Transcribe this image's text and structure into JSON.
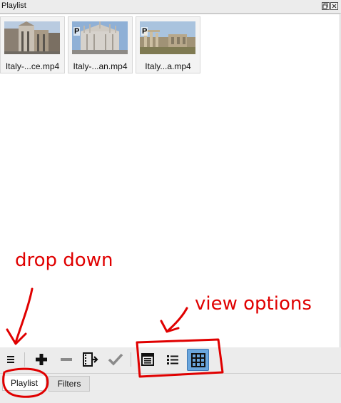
{
  "panel": {
    "title": "Playlist",
    "float_icon": "float-window-icon",
    "close_icon": "close-icon"
  },
  "playlist": {
    "items": [
      {
        "label": "Italy-...ce.mp4",
        "thumb": "florence-cathedral",
        "badge": ""
      },
      {
        "label": "Italy-...an.mp4",
        "thumb": "milan-cathedral",
        "badge": "P"
      },
      {
        "label": "Italy...a.mp4",
        "thumb": "roman-forum",
        "badge": "P"
      }
    ]
  },
  "annotations": {
    "dropdown": "drop down",
    "view_options": "view options",
    "color": "#e00000"
  },
  "toolbar": {
    "menu_icon": "hamburger-menu-icon",
    "add_icon": "plus-icon",
    "remove_icon": "minus-icon",
    "update_icon": "film-arrow-icon",
    "select_icon": "checkmark-icon",
    "view_details_icon": "details-view-icon",
    "view_list_icon": "list-view-icon",
    "view_tiles_icon": "tiles-view-icon",
    "selected_view": "tiles"
  },
  "tabs": {
    "playlist": "Playlist",
    "filters": "Filters",
    "active": "Playlist"
  }
}
